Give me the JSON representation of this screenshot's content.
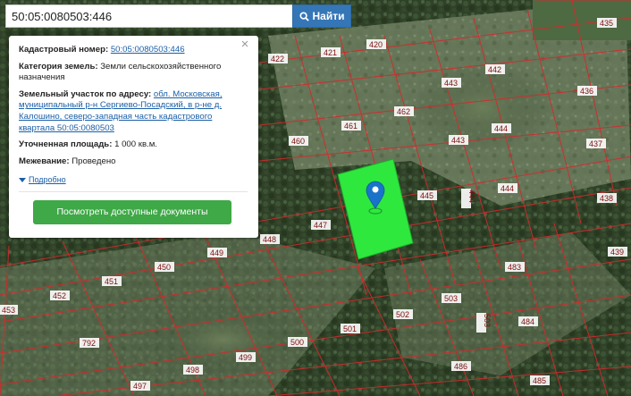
{
  "search": {
    "value": "50:05:0080503:446",
    "button_label": "Найти",
    "icon": "search-icon"
  },
  "panel": {
    "close_label": "×",
    "cadastral_number_label": "Кадастровый номер:",
    "cadastral_number": "50:05:0080503:446",
    "category_label": "Категория земель:",
    "category_value": "Земли сельскохозяйственного назначения",
    "address_label": "Земельный участок по адресу:",
    "address_value": "обл. Московская, муниципальный р-н Сергиево-Посадский, в р-не д. Калошино, северо-западная часть кадастрового квартала 50:05:0080503",
    "area_label": "Уточненная площадь:",
    "area_value": "1 000 кв.м.",
    "survey_label": "Межевание:",
    "survey_value": "Проведено",
    "details_link": "Подробно",
    "docs_button": "Посмотреть доступные документы"
  },
  "map": {
    "plot_numbers": [
      "435",
      "436",
      "437",
      "438",
      "439",
      "442",
      "443",
      "443",
      "444",
      "444",
      "445",
      "447",
      "448",
      "449",
      "450",
      "451",
      "452",
      "453",
      "460",
      "461",
      "462",
      "483",
      "484",
      "485",
      "486",
      "497",
      "498",
      "499",
      "500",
      "501",
      "502",
      "503",
      "503",
      "792",
      "420",
      "421",
      "422"
    ],
    "selected_plot_color": "#2ee83e",
    "boundary_color": "#d8282b",
    "marker_color": "#1a73c9",
    "icons": [
      "location-pin-icon",
      "search-icon",
      "close-icon",
      "caret-down-icon"
    ]
  }
}
